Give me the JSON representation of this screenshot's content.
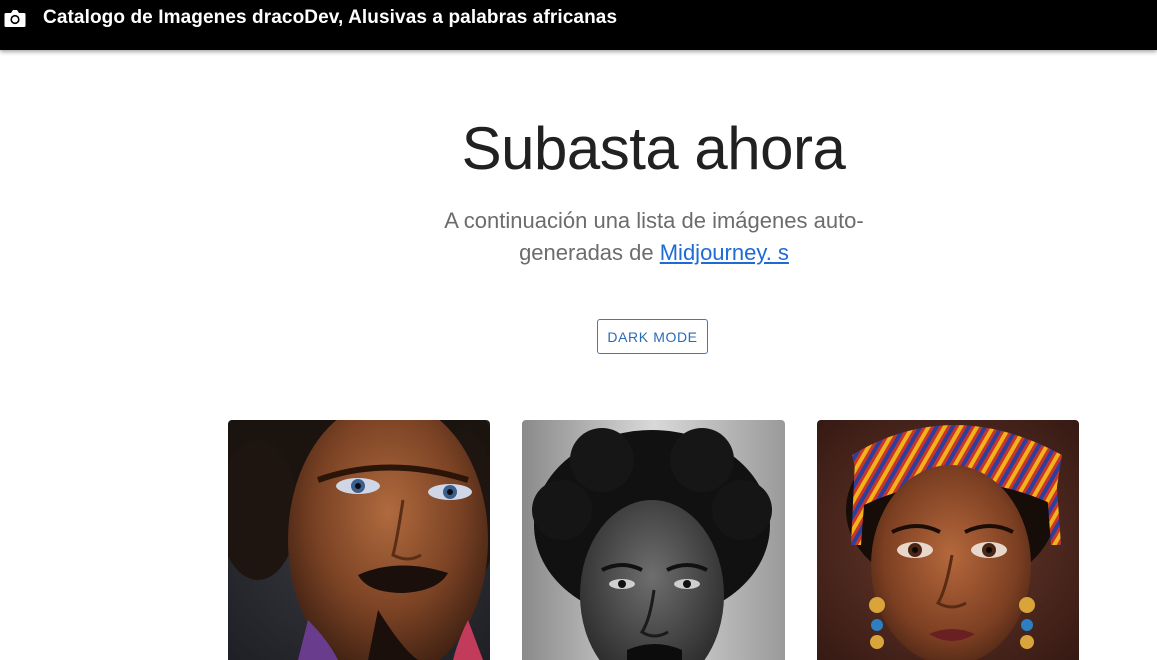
{
  "appbar": {
    "title": "Catalogo de Imagenes dracoDev, Alusivas a palabras africanas",
    "icon": "camera-icon"
  },
  "hero": {
    "heading": "Subasta ahora",
    "lead_text": "A continuación una lista de imágenes auto-generadas de ",
    "link_text": "Midjourney. s"
  },
  "actions": {
    "dark_mode_label": "DARK MODE"
  },
  "album": {
    "cards": [
      {
        "image": "portrait-man-curly-hair-blue-eyes"
      },
      {
        "image": "portrait-man-afro-black-and-white"
      },
      {
        "image": "portrait-woman-striped-headwrap"
      }
    ]
  }
}
